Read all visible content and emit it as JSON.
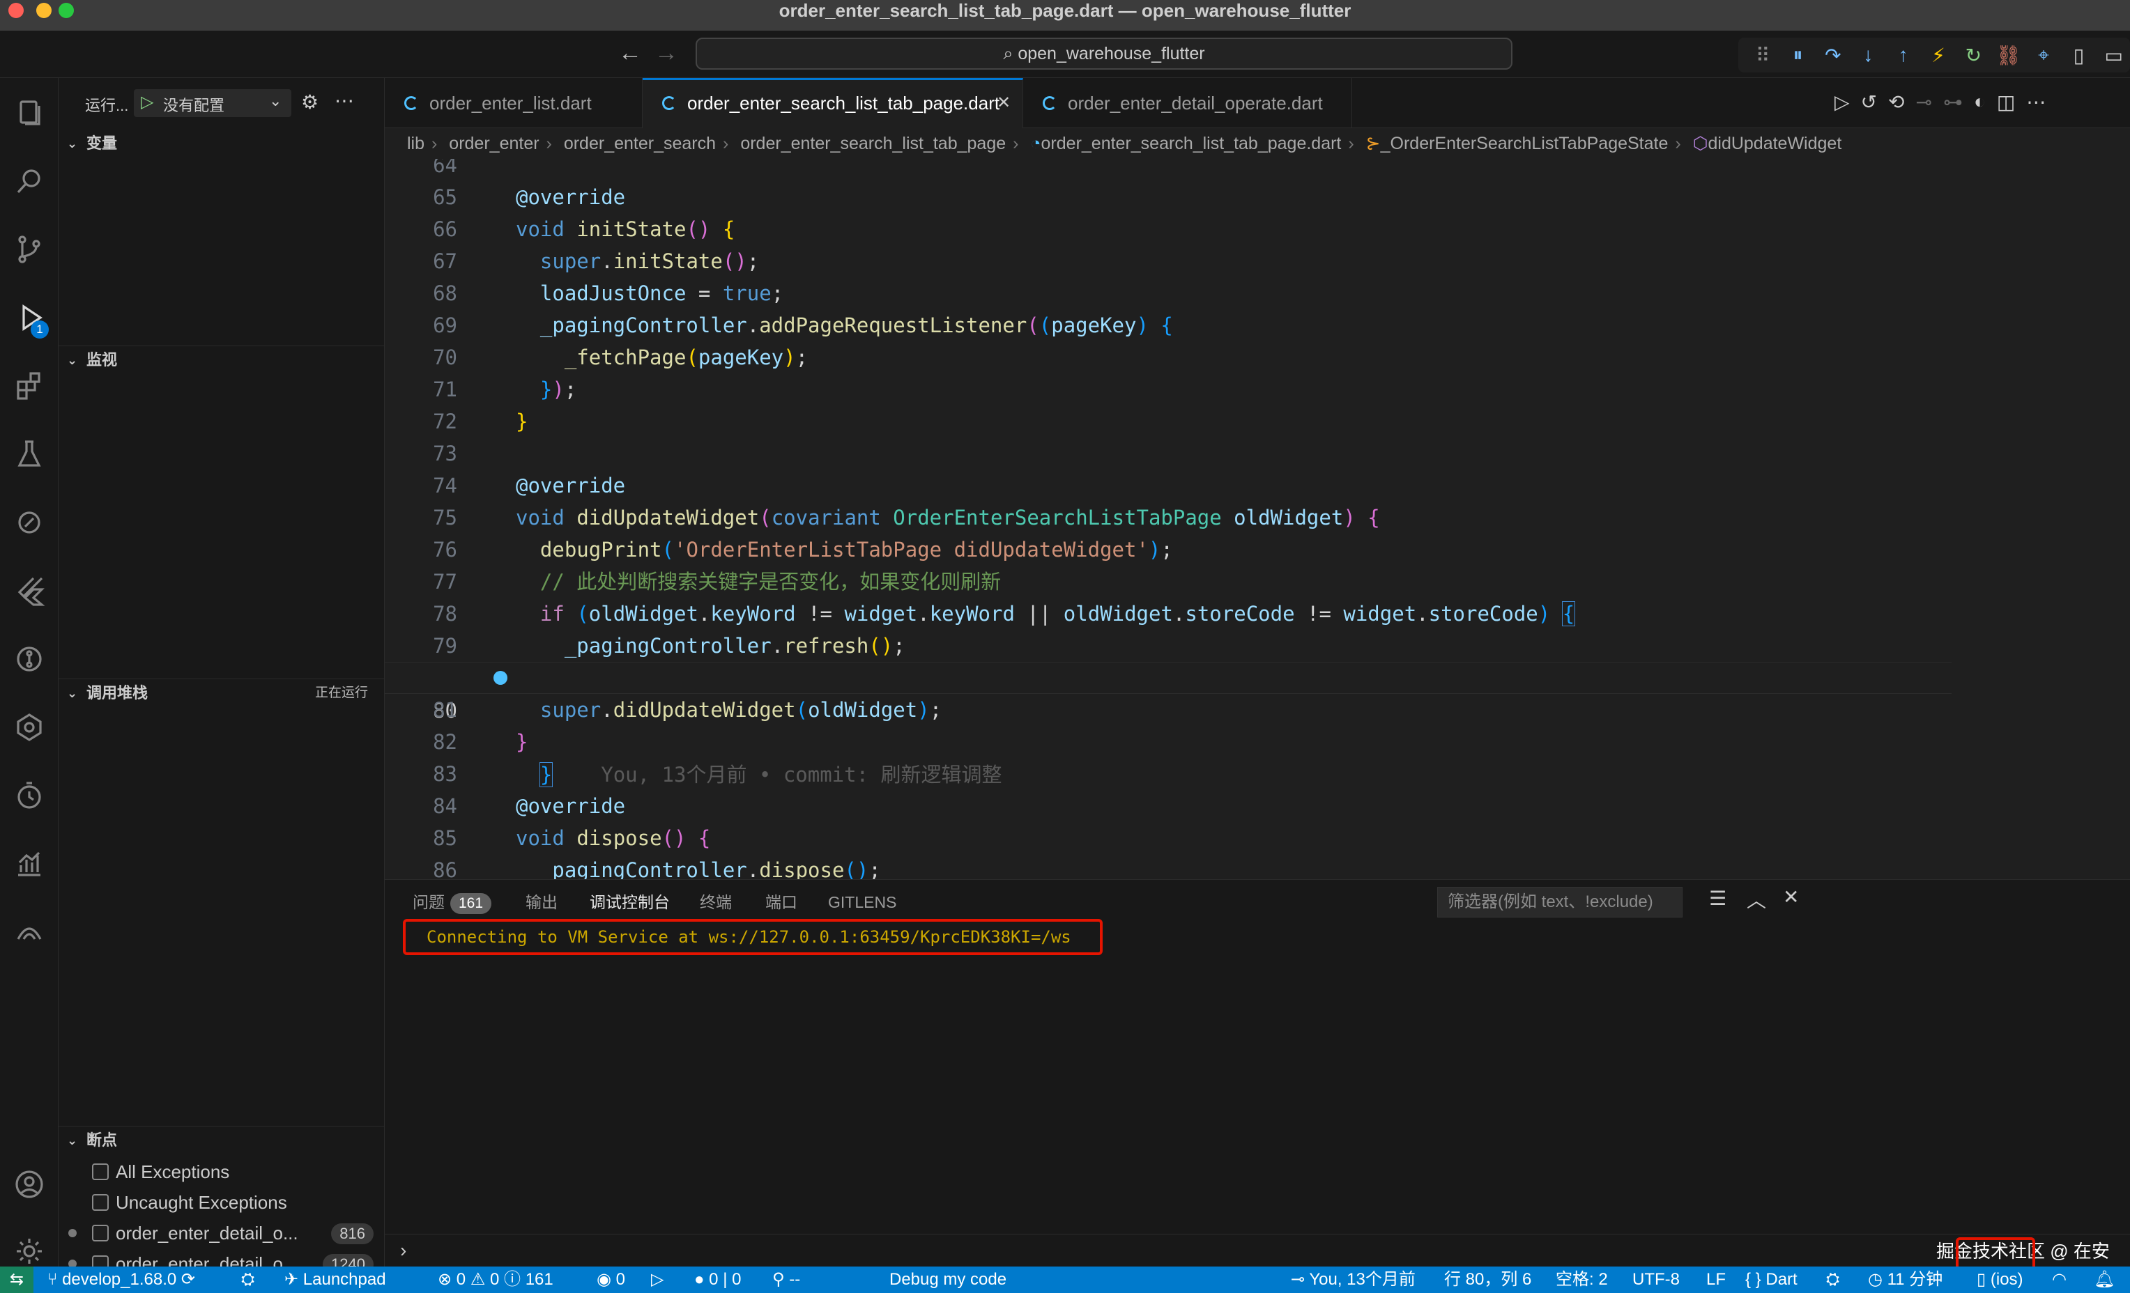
{
  "window": {
    "title": "order_enter_search_list_tab_page.dart — open_warehouse_flutter"
  },
  "command_center": {
    "label": "open_warehouse_flutter"
  },
  "sidebar": {
    "run_label": "运行...",
    "config": "没有配置",
    "variables": "变量",
    "watch": "监视",
    "callstack": "调用堆栈",
    "callstack_status": "正在运行",
    "breakpoints": "断点",
    "bp_items": [
      {
        "label": "All Exceptions"
      },
      {
        "label": "Uncaught Exceptions"
      },
      {
        "label": "order_enter_detail_o...",
        "count": "816"
      },
      {
        "label": "order_enter_detail_o...",
        "count": "1240"
      }
    ],
    "debug_badge": "1"
  },
  "tabs": [
    {
      "label": "order_enter_list.dart"
    },
    {
      "label": "order_enter_search_list_tab_page.dart",
      "close": "✕"
    },
    {
      "label": "order_enter_detail_operate.dart"
    }
  ],
  "breadcrumb": [
    "lib",
    "order_enter",
    "order_enter_search",
    "order_enter_search_list_tab_page",
    "order_enter_search_list_tab_page.dart",
    "_OrderEnterSearchListTabPageState",
    "didUpdateWidget"
  ],
  "editor": {
    "line_numbers": [
      "64",
      "65",
      "66",
      "67",
      "68",
      "69",
      "70",
      "71",
      "72",
      "73",
      "74",
      "75",
      "76",
      "77",
      "78",
      "79",
      "80",
      "81",
      "82",
      "83",
      "84",
      "85",
      "86"
    ],
    "blame": "You, 13个月前 • commit: 刷新逻辑调整"
  },
  "panel": {
    "tabs": [
      "问题",
      "输出",
      "调试控制台",
      "终端",
      "端口",
      "GITLENS"
    ],
    "problems_count": "161",
    "filter_placeholder": "筛选器(例如 text、!exclude)",
    "console_line": "Connecting to VM Service at ws://127.0.0.1:63459/KprcEDK38KI=/ws",
    "prompt": "›",
    "watermark": "掘金技术社区 @ 在安"
  },
  "statusbar": {
    "branch": "develop_1.68.0",
    "launchpad": "Launchpad",
    "errors": "0",
    "warnings": "0",
    "infos": "161",
    "ports": "0",
    "counts": "0 | 0",
    "flutter": "--",
    "debug_code": "Debug my code",
    "blame": "You, 13个月前",
    "position": "行 80，列 6",
    "spaces": "空格: 2",
    "encoding": "UTF-8",
    "eol": "LF",
    "language": "Dart",
    "time": "11 分钟",
    "device": "(ios)"
  },
  "colors": {
    "accent": "#007acc",
    "error_box": "#e51400",
    "console_text": "#cca700"
  }
}
